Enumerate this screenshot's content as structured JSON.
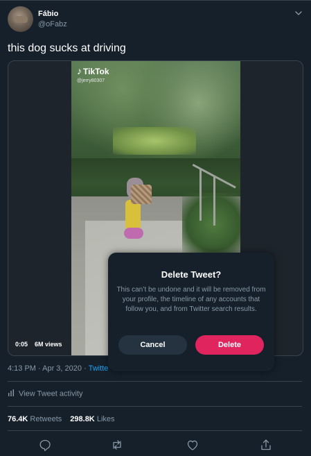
{
  "author": {
    "name": "Fábio",
    "handle": "@oFabz"
  },
  "tweet": {
    "text": "this dog sucks at driving"
  },
  "media": {
    "watermark_brand": "TikTok",
    "watermark_user": "@jerry80307",
    "time": "0:05",
    "views": "6M views"
  },
  "meta": {
    "timestamp": "4:13 PM · Apr 3, 2020 ·",
    "source_partial": "Twitte"
  },
  "activity": {
    "label": "View Tweet activity"
  },
  "stats": {
    "retweets_count": "76.4K",
    "retweets_label": "Retweets",
    "likes_count": "298.8K",
    "likes_label": "Likes"
  },
  "icons": {
    "menu": "chevron-down-icon",
    "reply": "reply-icon",
    "retweet": "retweet-icon",
    "like": "heart-icon",
    "share": "share-icon",
    "activity": "bar-chart-icon"
  },
  "modal": {
    "title": "Delete Tweet?",
    "body": "This can’t be undone and it will be removed from your profile, the timeline of any accounts that follow you, and from Twitter search results.",
    "cancel_label": "Cancel",
    "delete_label": "Delete"
  },
  "colors": {
    "background": "#15202b",
    "border": "#38444d",
    "secondary_text": "#8899a6",
    "accent": "#1da1f2",
    "danger": "#e0245e",
    "cancel_button": "#253341"
  }
}
